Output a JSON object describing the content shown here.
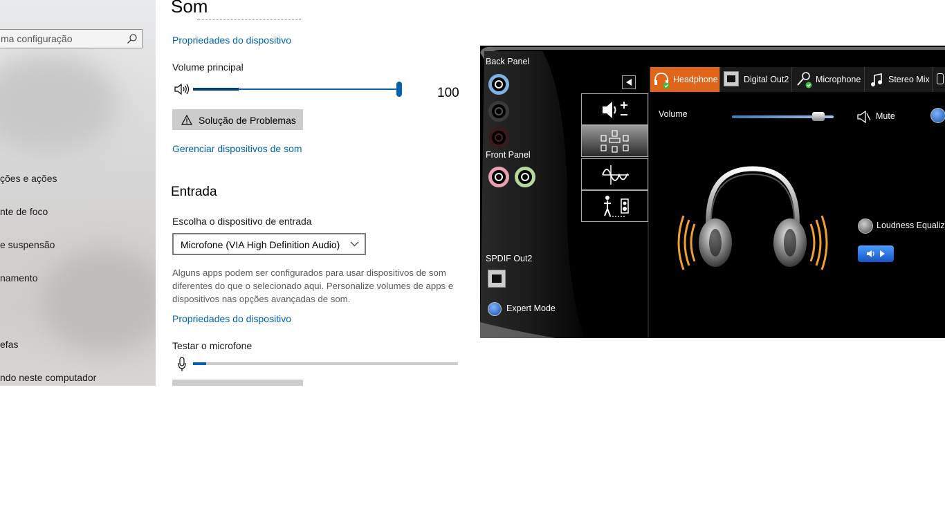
{
  "sidebar": {
    "search_placeholder": "ma configuração",
    "items": [
      {
        "label": "ções e ações"
      },
      {
        "label": "nte de foco"
      },
      {
        "label": "e suspensão"
      },
      {
        "label": "namento"
      },
      {
        "label": "efas"
      },
      {
        "label": "ndo neste computador"
      }
    ]
  },
  "main": {
    "title": "Som",
    "device_props_link": "Propriedades do dispositivo",
    "master_volume_label": "Volume principal",
    "master_volume_value": "100",
    "master_volume_level": 1.0,
    "troubleshoot_label": "Solução de Problemas",
    "manage_devices_link": "Gerenciar dispositivos de som",
    "input_heading": "Entrada",
    "choose_input_label": "Escolha o dispositivo de entrada",
    "input_device": "Microfone (VIA High Definition Audio)",
    "info_lines": [
      "Alguns apps podem ser configurados para usar dispositivos de som",
      "diferentes do que o selecionado aqui. Personalize volumes de apps e",
      "dispositivos nas opções avançadas de som."
    ],
    "input_props_link": "Propriedades do dispositivo",
    "test_mic_label": "Testar o microfone",
    "mic_level": 0.05
  },
  "audio_panel": {
    "back_panel": "Back Panel",
    "front_panel": "Front Panel",
    "spdif": "SPDIF Out2",
    "expert_mode": "Expert Mode",
    "tabs": [
      {
        "label": "Headphone",
        "active": true
      },
      {
        "label": "Digital Out2",
        "active": false
      },
      {
        "label": "Microphone",
        "active": false
      },
      {
        "label": "Stereo Mix",
        "active": false
      }
    ],
    "volume_label": "Volume",
    "volume_level": 0.9,
    "mute_label": "Mute",
    "loudness_label": "Loudness Equalization",
    "colors": {
      "accent": "#0063b1",
      "active_tab": "#e0651a",
      "panel_bg": "#000000"
    }
  }
}
